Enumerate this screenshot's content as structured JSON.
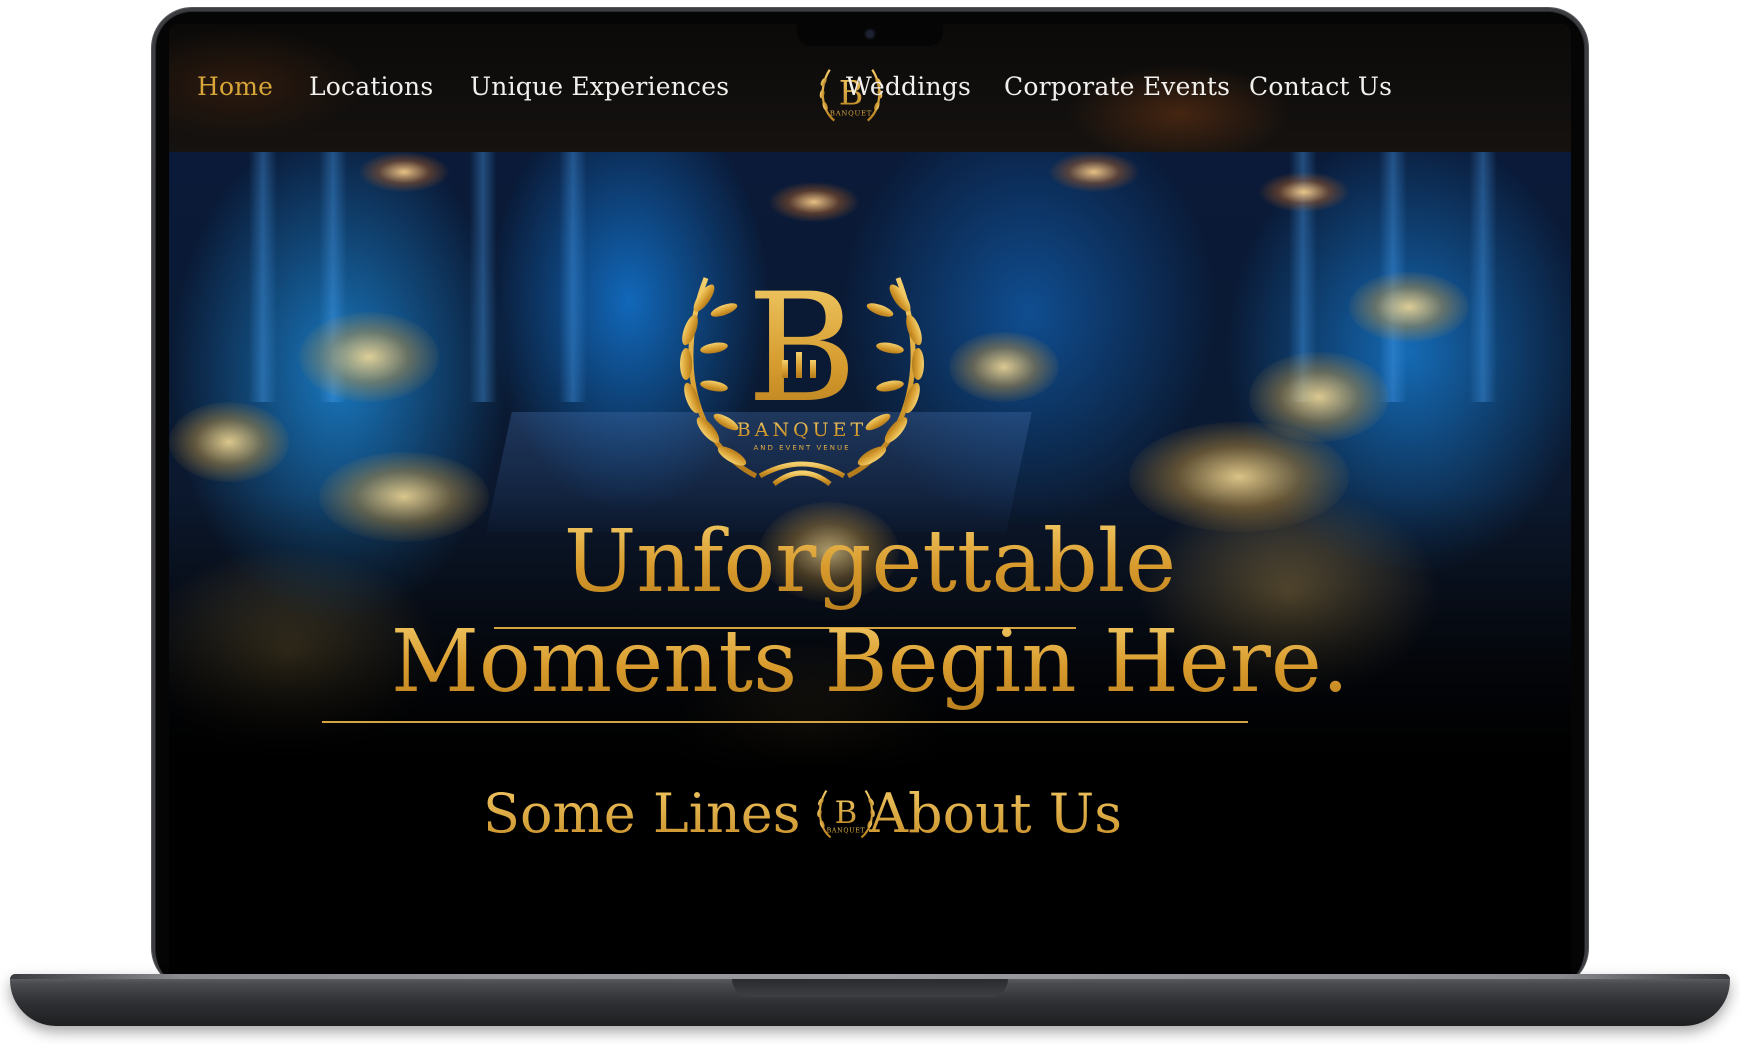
{
  "nav": {
    "items": [
      {
        "label": "Home",
        "active": true
      },
      {
        "label": "Locations",
        "active": false
      },
      {
        "label": "Unique Experiences",
        "active": false
      },
      {
        "label": "Weddings",
        "active": false
      },
      {
        "label": "Corporate Events",
        "active": false
      },
      {
        "label": "Contact Us",
        "active": false
      }
    ],
    "logo_icon": "banquet-laurel-logo-icon"
  },
  "hero": {
    "emblem_icon": "banquet-laurel-emblem-icon",
    "emblem_wordmark": "BANQUET",
    "emblem_tagline": "AND EVENT VENUE",
    "headline_line1": "Unforgettable",
    "headline_line2": "Moments Begin Here."
  },
  "about": {
    "left_text": "Some Lines",
    "right_text": "About Us",
    "logo_icon": "banquet-laurel-logo-icon"
  },
  "colors": {
    "gold": "#d8a638",
    "nav_text": "#f2f0ec",
    "background": "#000000",
    "hero_blue": "#1e8ceb"
  }
}
